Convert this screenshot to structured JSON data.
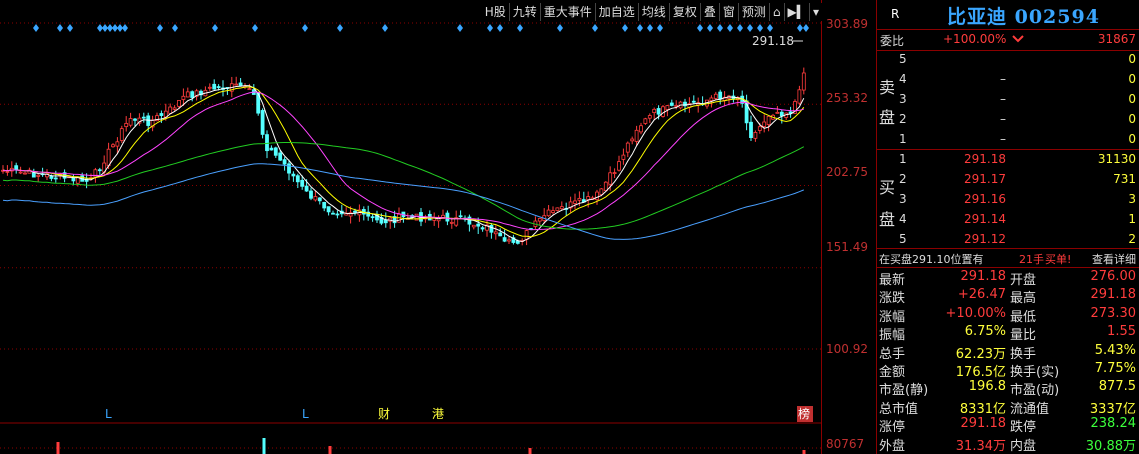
{
  "toolbar": {
    "buttons": [
      "H股",
      "九转",
      "重大事件",
      "加自选",
      "均线",
      "复权",
      "叠",
      "窗",
      "预测",
      "⌂",
      "▶▍",
      "▾"
    ]
  },
  "price_axis": [
    "303.89",
    "253.32",
    "202.75",
    "151.49",
    "100.92"
  ],
  "volume_axis": [
    "80767"
  ],
  "last_price_tag": "291.18",
  "markers": {
    "l1": "L",
    "l2": "L",
    "cai": "财",
    "gang": "港",
    "bang": "榜"
  },
  "header": {
    "r": "R",
    "title": "比亚迪 002594"
  },
  "weibi": {
    "label": "委比",
    "pct": "+100.00%",
    "diff": "31867"
  },
  "sell_side_label": [
    "卖",
    "盘"
  ],
  "buy_side_label": [
    "买",
    "盘"
  ],
  "sell_orders": [
    {
      "level": "5",
      "price": "",
      "volume": "0"
    },
    {
      "level": "4",
      "price": "–",
      "volume": "0"
    },
    {
      "level": "3",
      "price": "–",
      "volume": "0"
    },
    {
      "level": "2",
      "price": "–",
      "volume": "0"
    },
    {
      "level": "1",
      "price": "–",
      "volume": "0"
    }
  ],
  "buy_orders": [
    {
      "level": "1",
      "price": "291.18",
      "volume": "31130"
    },
    {
      "level": "2",
      "price": "291.17",
      "volume": "731"
    },
    {
      "level": "3",
      "price": "291.16",
      "volume": "3"
    },
    {
      "level": "4",
      "price": "291.14",
      "volume": "1"
    },
    {
      "level": "5",
      "price": "291.12",
      "volume": "2"
    }
  ],
  "note": {
    "text": "在买盘291.10位置有",
    "hands": "21手",
    "buy": "买单!",
    "link": "查看详细"
  },
  "stats": [
    {
      "l1": "最新",
      "v1": "291.18",
      "c1": "red",
      "l2": "开盘",
      "v2": "276.00",
      "c2": "red"
    },
    {
      "l1": "涨跌",
      "v1": "+26.47",
      "c1": "red",
      "l2": "最高",
      "v2": "291.18",
      "c2": "red"
    },
    {
      "l1": "涨幅",
      "v1": "+10.00%",
      "c1": "red",
      "l2": "最低",
      "v2": "273.30",
      "c2": "red"
    },
    {
      "l1": "振幅",
      "v1": "6.75%",
      "c1": "yel",
      "l2": "量比",
      "v2": "1.55",
      "c2": "red"
    },
    {
      "l1": "总手",
      "v1": "62.23万",
      "c1": "yel",
      "l2": "换手",
      "v2": "5.43%",
      "c2": "yel"
    },
    {
      "l1": "金额",
      "v1": "176.5亿",
      "c1": "yel",
      "l2": "换手(实)",
      "v2": "7.75%",
      "c2": "yel"
    },
    {
      "l1": "市盈(静)",
      "v1": "196.8",
      "c1": "yel",
      "l2": "市盈(动)",
      "v2": "877.5",
      "c2": "yel"
    },
    {
      "l1": "总市值",
      "v1": "8331亿",
      "c1": "yel",
      "l2": "流通值",
      "v2": "3337亿",
      "c2": "yel"
    },
    {
      "l1": "涨停",
      "v1": "291.18",
      "c1": "red",
      "l2": "跌停",
      "v2": "238.24",
      "c2": "grn"
    },
    {
      "l1": "外盘",
      "v1": "31.34万",
      "c1": "red",
      "l2": "内盘",
      "v2": "30.88万",
      "c2": "grn"
    }
  ],
  "colors": {
    "up": "#ff3c3c",
    "down": "#54ffff",
    "grid": "#8b0000",
    "ma5": "#ffffff",
    "ma10": "#ffff00",
    "ma20": "#ff44ff",
    "ma60": "#22cc22",
    "ma120": "#4aa0ff"
  }
}
